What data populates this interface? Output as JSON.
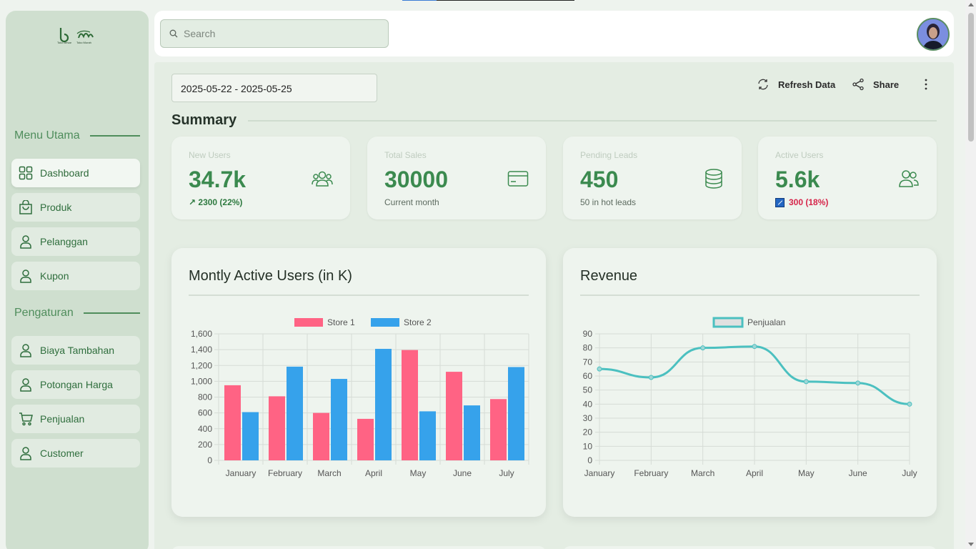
{
  "logo": {
    "text_left": "Toko Besar",
    "text_right": "Toko Murah"
  },
  "sidebar": {
    "section_main": "Menu Utama",
    "main_items": [
      {
        "label": "Dashboard",
        "icon": "grid-icon",
        "active": true
      },
      {
        "label": "Produk",
        "icon": "bag-icon"
      },
      {
        "label": "Pelanggan",
        "icon": "user-icon"
      },
      {
        "label": "Kupon",
        "icon": "user-icon"
      }
    ],
    "section_settings": "Pengaturan",
    "settings_items": [
      {
        "label": "Biaya Tambahan",
        "icon": "user-icon"
      },
      {
        "label": "Potongan Harga",
        "icon": "user-icon"
      },
      {
        "label": "Penjualan",
        "icon": "cart-icon"
      },
      {
        "label": "Customer",
        "icon": "user-icon"
      }
    ]
  },
  "header": {
    "search_placeholder": "Search"
  },
  "toolbar": {
    "date_range": "2025-05-22 - 2025-05-25",
    "refresh_label": "Refresh Data",
    "share_label": "Share"
  },
  "summary": {
    "title": "Summary",
    "stats": [
      {
        "label": "New Users",
        "value": "34.7k",
        "sub": "↗ 2300 (22%)",
        "icon": "users-group-icon"
      },
      {
        "label": "Total Sales",
        "value": "30000",
        "sub": "Current month",
        "icon": "credit-card-icon"
      },
      {
        "label": "Pending Leads",
        "value": "450",
        "sub": "50 in hot leads",
        "icon": "database-icon"
      },
      {
        "label": "Active Users",
        "value": "5.6k",
        "sub": "300 (18%)",
        "icon": "users-icon"
      }
    ]
  },
  "colors": {
    "accent": "#3b8a4f",
    "store1": "#ff6384",
    "store2": "#36a2eb",
    "revenue": "#4bc0c0",
    "negative": "#d6254a"
  },
  "chart_data": [
    {
      "type": "bar",
      "title": "Montly Active Users (in K)",
      "categories": [
        "January",
        "February",
        "March",
        "April",
        "May",
        "June",
        "July"
      ],
      "series": [
        {
          "name": "Store 1",
          "values": [
            950,
            810,
            600,
            525,
            1395,
            1120,
            775
          ]
        },
        {
          "name": "Store 2",
          "values": [
            610,
            1185,
            1030,
            1410,
            620,
            695,
            1180
          ]
        }
      ],
      "ylim": [
        0,
        1600
      ],
      "yticks": [
        "0",
        "200",
        "400",
        "600",
        "800",
        "1,000",
        "1,200",
        "1,400",
        "1,600"
      ],
      "grid": true,
      "legend": "top"
    },
    {
      "type": "line",
      "title": "Revenue",
      "categories": [
        "January",
        "February",
        "March",
        "April",
        "May",
        "June",
        "July"
      ],
      "series": [
        {
          "name": "Penjualan",
          "values": [
            65,
            59,
            80,
            81,
            56,
            55,
            40
          ]
        }
      ],
      "ylim": [
        0,
        90
      ],
      "yticks": [
        "0",
        "10",
        "20",
        "30",
        "40",
        "50",
        "60",
        "70",
        "80",
        "90"
      ],
      "grid": true,
      "legend": "top"
    }
  ]
}
